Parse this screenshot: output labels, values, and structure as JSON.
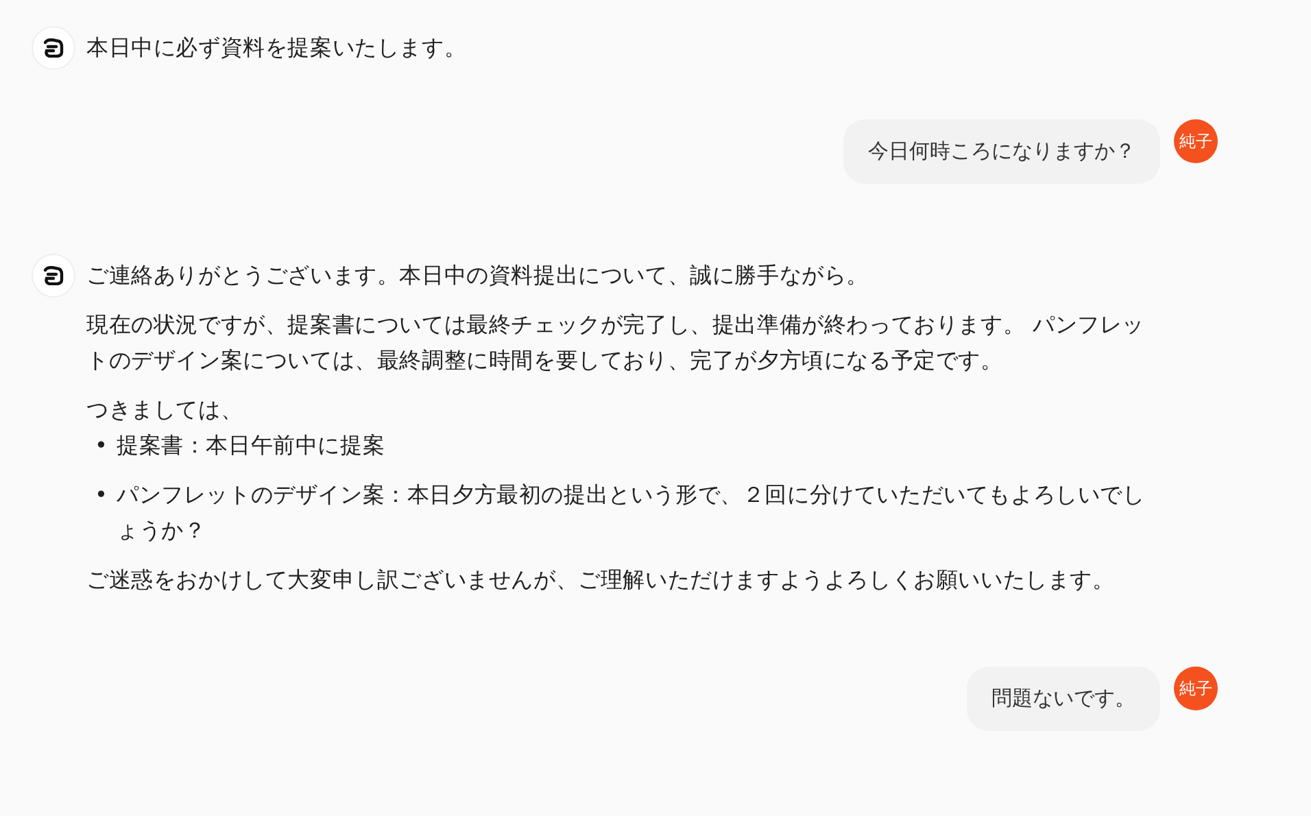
{
  "messages": [
    {
      "kind": "bot",
      "blocks": [
        {
          "kind": "paragraph",
          "text": "本日中に必ず資料を提案いたします。"
        }
      ]
    },
    {
      "kind": "user",
      "avatar": "純子",
      "text": "今日何時ころになりますか？"
    },
    {
      "kind": "bot",
      "blocks": [
        {
          "kind": "paragraph",
          "text": "ご連絡ありがとうございます。本日中の資料提出について、誠に勝手ながら。"
        },
        {
          "kind": "paragraph",
          "text": "現在の状況ですが、提案書については最終チェックが完了し、提出準備が終わっております。 パンフレットのデザイン案については、最終調整に時間を要しており、完了が夕方頃になる予定です。"
        },
        {
          "kind": "list",
          "intro": "つきましては、",
          "items": [
            {
              "marker": "•",
              "text": "提案書：本日午前中に提案"
            },
            {
              "marker": "•",
              "text": "パンフレットのデザイン案：本日夕方最初の提出という形で、２回に分けていただいてもよろしいでしょうか？"
            }
          ]
        },
        {
          "kind": "paragraph",
          "text": "ご迷惑をおかけして大変申し訳ございませんが、ご理解いただけますようよろしくお願いいたします。"
        }
      ]
    },
    {
      "kind": "user",
      "avatar": "純子",
      "text": "問題ないです。"
    }
  ]
}
